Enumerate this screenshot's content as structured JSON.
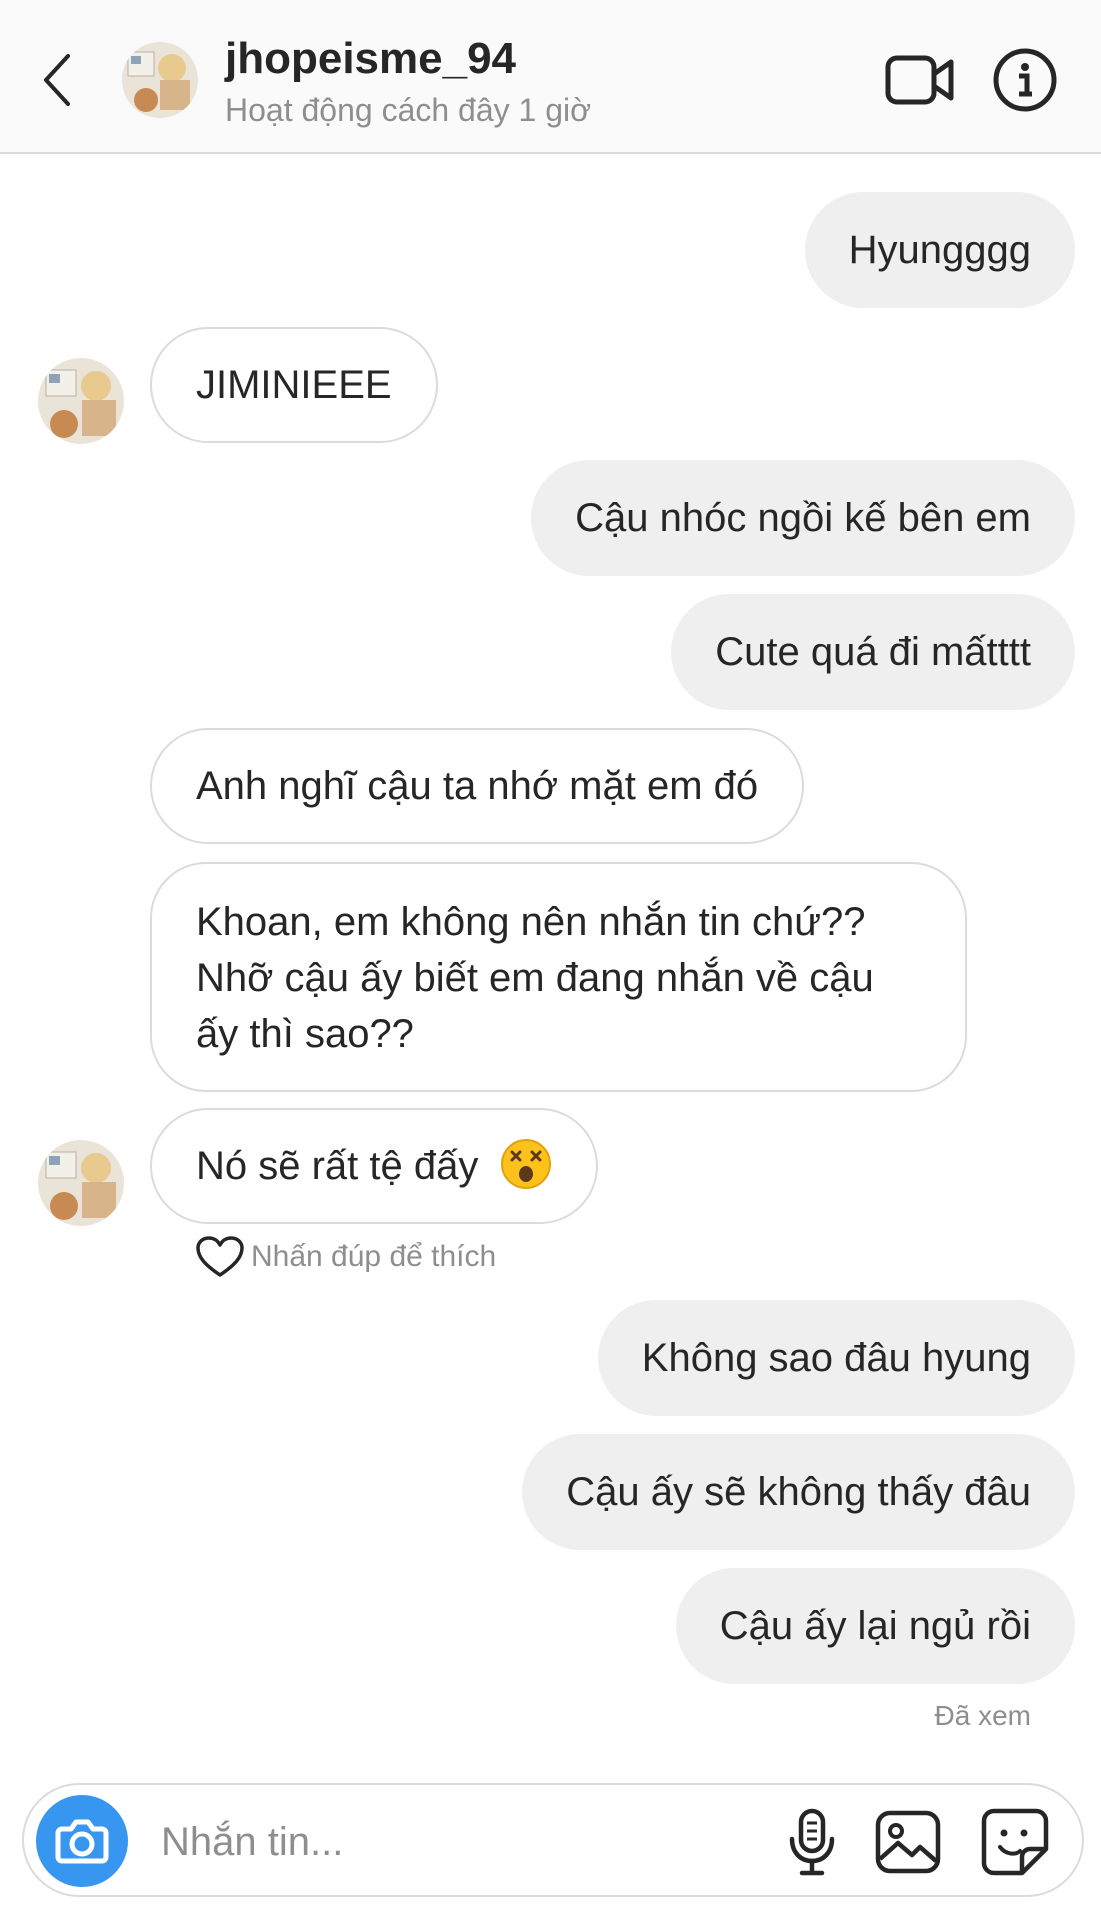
{
  "header": {
    "back_icon": "chevron-left-icon",
    "username": "jhopeisme_94",
    "status": "Hoạt động cách đây 1 giờ",
    "video_icon": "video-camera-icon",
    "info_icon": "info-icon"
  },
  "messages": [
    {
      "from": "me",
      "text": "Hyungggg"
    },
    {
      "from": "them",
      "text": "JIMINIEEE"
    },
    {
      "from": "me",
      "text": "Cậu nhóc ngồi kế bên em"
    },
    {
      "from": "me",
      "text": "Cute quá đi mấtttt"
    },
    {
      "from": "them",
      "text": "Anh nghĩ cậu ta nhớ mặt em đó"
    },
    {
      "from": "them",
      "text": "Khoan, em không nên nhắn tin chứ?? Nhỡ cậu ấy biết em đang nhắn về cậu ấy thì sao??"
    },
    {
      "from": "them",
      "text": "Nó sẽ rất tệ đấy",
      "emoji": "dizzy-face-emoji"
    },
    {
      "from": "me",
      "text": "Không sao đâu hyung"
    },
    {
      "from": "me",
      "text": "Cậu ấy sẽ không thấy đâu"
    },
    {
      "from": "me",
      "text": "Cậu ấy lại ngủ rồi"
    }
  ],
  "like_hint": "Nhấn đúp để thích",
  "seen_label": "Đã xem",
  "composer": {
    "placeholder": "Nhắn tin...",
    "camera_icon": "camera-icon",
    "mic_icon": "microphone-icon",
    "gallery_icon": "image-icon",
    "sticker_icon": "sticker-icon"
  },
  "colors": {
    "accent": "#3797f0",
    "outgoing_bubble": "#efefef",
    "border": "#dbdbdb",
    "muted_text": "#8e8e8e"
  }
}
